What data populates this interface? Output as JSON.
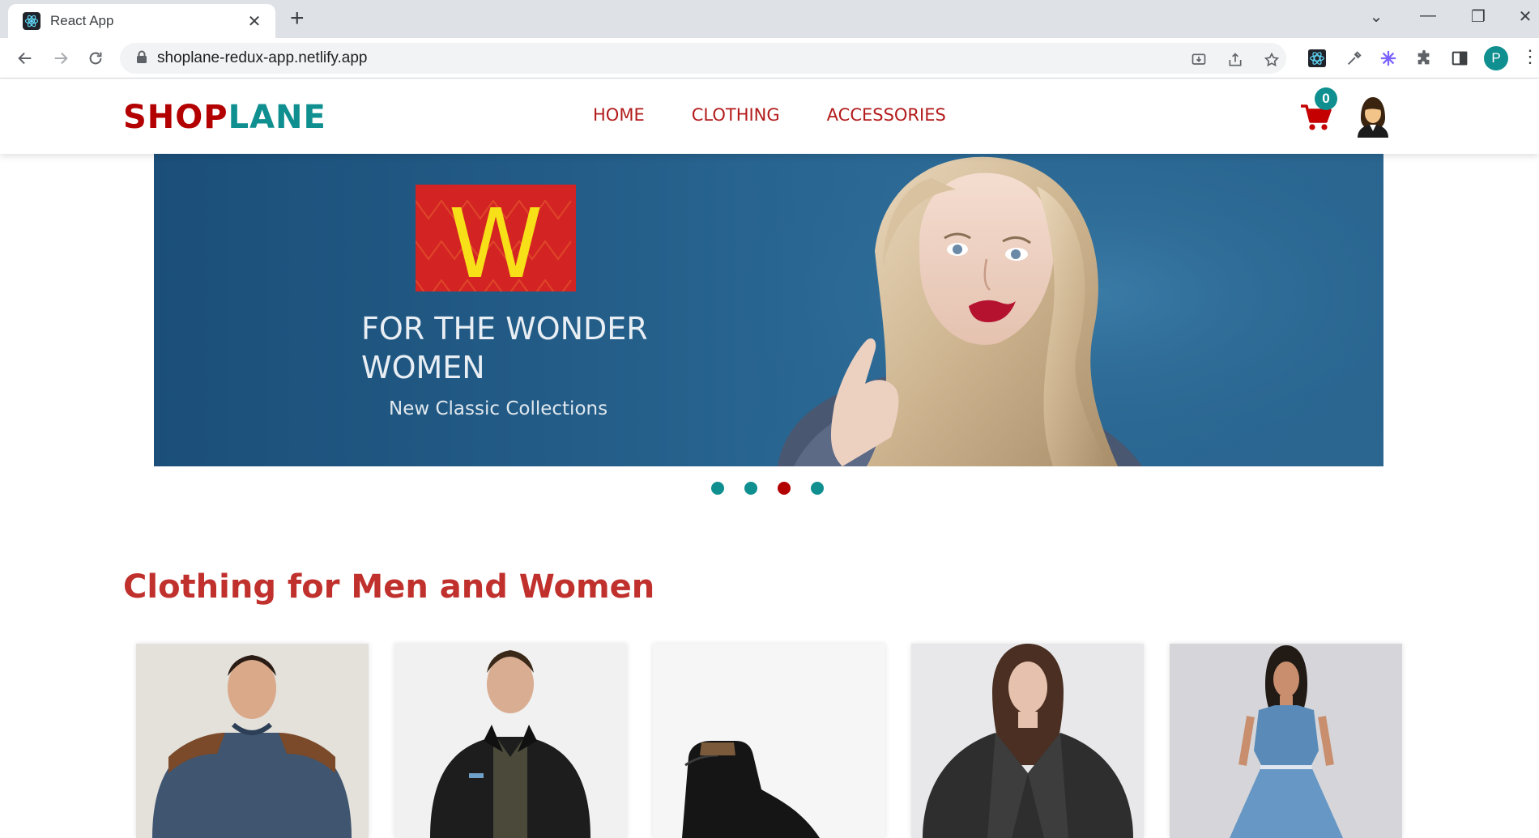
{
  "browser": {
    "tab_title": "React App",
    "tab_close": "✕",
    "new_tab": "+",
    "url": "shoplane-redux-app.netlify.app",
    "profile_initial": "P",
    "window_controls": [
      "⌄",
      "—",
      "❐",
      "✕"
    ]
  },
  "site": {
    "logo_part1": "SHOP",
    "logo_part2": "LANE",
    "nav": [
      "HOME",
      "CLOTHING",
      "ACCESSORIES"
    ],
    "cart_count": "0"
  },
  "banner": {
    "brand_letter": "W",
    "title": "FOR THE WONDER WOMEN",
    "subtitle": "New Classic Collections",
    "slides": 4,
    "active_slide": 3
  },
  "section": {
    "title": "Clothing for Men and Women"
  },
  "products": [
    {
      "name": "mens-sweater-card"
    },
    {
      "name": "mens-jacket-card"
    },
    {
      "name": "boot-card"
    },
    {
      "name": "womens-leather-jacket-card"
    },
    {
      "name": "denim-dress-card"
    }
  ],
  "colors": {
    "brand_red": "#b30000",
    "brand_teal": "#0f8f8f",
    "nav_red": "#b31b1b",
    "section_red": "#c0302c",
    "banner_blue": "#235d88"
  }
}
